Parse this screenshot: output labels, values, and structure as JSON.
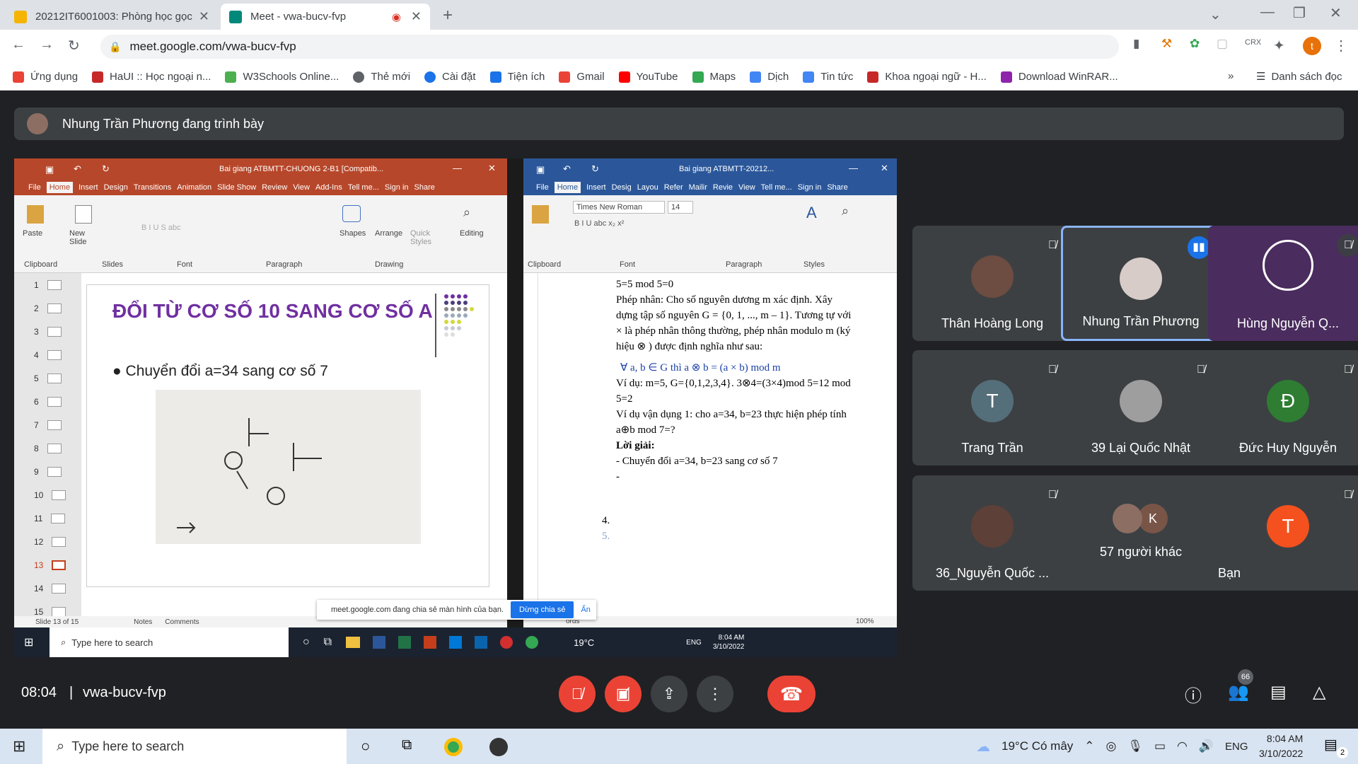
{
  "tabs": [
    {
      "title": "20212IT6001003: Phòng học gọc",
      "color": "#f4b400"
    },
    {
      "title": "Meet - vwa-bucv-fvp",
      "color": "#00897b"
    }
  ],
  "url": "meet.google.com/vwa-bucv-fvp",
  "bookmarks": [
    {
      "label": "Ứng dụng",
      "color": "#ea4335"
    },
    {
      "label": "HaUI :: Học ngoại n...",
      "color": "#c62828"
    },
    {
      "label": "W3Schools Online...",
      "color": "#4caf50"
    },
    {
      "label": "Thẻ mới",
      "color": "#5f6368"
    },
    {
      "label": "Cài đặt",
      "color": "#1a73e8"
    },
    {
      "label": "Tiện ích",
      "color": "#1a73e8"
    },
    {
      "label": "Gmail",
      "color": "#ea4335"
    },
    {
      "label": "YouTube",
      "color": "#ff0000"
    },
    {
      "label": "Maps",
      "color": "#34a853"
    },
    {
      "label": "Dịch",
      "color": "#4285f4"
    },
    {
      "label": "Tin tức",
      "color": "#4285f4"
    },
    {
      "label": "Khoa ngoại ngữ - H...",
      "color": "#c62828"
    },
    {
      "label": "Download WinRAR...",
      "color": "#8e24aa"
    }
  ],
  "bookmarks_more": "»",
  "reading_list": "Danh sách đọc",
  "presenter_text": "Nhung Trần Phương đang trình bày",
  "ppt": {
    "title": "Bai giang ATBMTT-CHUONG 2-B1 [Compatib...",
    "tabs": [
      "File",
      "Home",
      "Insert",
      "Design",
      "Transitions",
      "Animation",
      "Slide Show",
      "Review",
      "View",
      "Add-Ins",
      "Tell me...",
      "Sign in",
      "Share"
    ],
    "groups": [
      "Clipboard",
      "Slides",
      "Font",
      "Paragraph",
      "Drawing",
      "Editing"
    ],
    "buttons": [
      "Paste",
      "New Slide",
      "Shapes",
      "Arrange",
      "Quick Styles"
    ],
    "thumbs": [
      "1",
      "2",
      "3",
      "4",
      "5",
      "6",
      "7",
      "8",
      "9",
      "10",
      "11",
      "12",
      "13",
      "14",
      "15"
    ],
    "slide_title": "ĐỔI TỪ CƠ SỐ 10 SANG CƠ SỐ A",
    "slide_bullet": "Chuyển đổi a=34 sang cơ số 7",
    "status_slide": "Slide 13 of 15",
    "status_notes": "Notes",
    "status_comments": "Comments"
  },
  "word": {
    "title": "Bai giang ATBMTT-20212...",
    "tabs": [
      "File",
      "Home",
      "Insert",
      "Desig",
      "Layou",
      "Refer",
      "Mailir",
      "Revie",
      "View",
      "Tell me...",
      "Sign in",
      "Share"
    ],
    "font": "Times New Roman",
    "size": "14",
    "groups": [
      "Clipboard",
      "Font",
      "Paragraph",
      "Styles"
    ],
    "lines": [
      "5=5 mod 5=0",
      "Phép nhân: Cho số nguyên dương m xác định. Xây dựng tập số nguyên G = {0, 1, ..., m – 1}. Tương tự với × là phép nhân thông thường, phép nhân modulo m (ký hiệu ⊗ ) được định nghĩa như sau:",
      "∀ a, b ∈ G thì a ⊗ b = (a × b) mod m",
      "Ví dụ: m=5, G={0,1,2,3,4}. 3⊗4=(3×4)mod 5=12 mod 5=2",
      "Ví dụ vận dụng 1: cho a=34, b=23 thực hiện phép tính a⊕b mod 7=?",
      "Lời giải:",
      "-   Chuyển đổi a=34, b=23 sang cơ số 7",
      "-",
      "4.",
      "5."
    ],
    "status_words": "ords",
    "zoom": "100%"
  },
  "inner_taskbar": {
    "search": "Type here to search",
    "weather": "19°C",
    "lang": "ENG",
    "time": "8:04 AM",
    "date": "3/10/2022"
  },
  "notification": {
    "text": "meet.google.com đang chia sẻ màn hình của bạn.",
    "stop": "Dừng chia sẻ",
    "hide": "Ẩn"
  },
  "participants": [
    {
      "name": "Thân Hoàng Long",
      "initial": "",
      "color": "#6d4c41",
      "muted": true
    },
    {
      "name": "Nhung Trần Phương",
      "initial": "",
      "color": "#d7ccc8",
      "muted": false,
      "active": true
    },
    {
      "name": "Hùng Nguyễn Q...",
      "initial": "",
      "color": "#4a2c5e",
      "muted": true
    },
    {
      "name": "Trang Trần",
      "initial": "T",
      "color": "#546e7a",
      "muted": true
    },
    {
      "name": "39 Lại Quốc Nhật",
      "initial": "",
      "color": "#9e9e9e",
      "muted": true
    },
    {
      "name": "Đức Huy Nguyễn",
      "initial": "Đ",
      "color": "#2e7d32",
      "muted": true
    },
    {
      "name": "36_Nguyễn Quốc ...",
      "initial": "",
      "color": "#5d4037",
      "muted": true
    },
    {
      "name": "57 người khác",
      "initial": "K",
      "color": "#795548",
      "muted": false
    },
    {
      "name": "Bạn",
      "initial": "T",
      "color": "#f4511e",
      "muted": true
    }
  ],
  "meeting_time": "08:04",
  "meeting_code": "vwa-bucv-fvp",
  "people_count": "66",
  "taskbar": {
    "search": "Type here to search",
    "weather": "19°C  Có mây",
    "lang": "ENG",
    "time": "8:04 AM",
    "date": "3/10/2022",
    "notif_count": "2"
  }
}
